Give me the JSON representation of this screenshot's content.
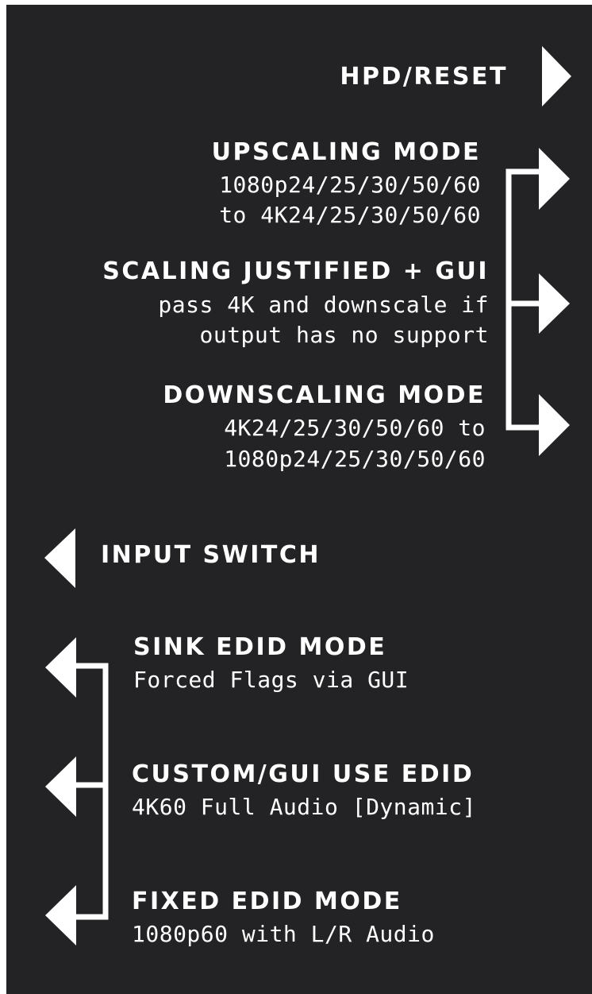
{
  "colors": {
    "background": "#232224",
    "foreground": "#ffffff",
    "page": "#ffffff"
  },
  "right_group": {
    "hpd_reset": {
      "title": "HPD/RESET",
      "icon": "arrow-right-icon"
    },
    "upscaling": {
      "title": "UPSCALING MODE",
      "line1": "1080p24/25/30/50/60",
      "line2": "to 4K24/25/30/50/60",
      "icon": "arrow-right-icon"
    },
    "scaling_justified": {
      "title": "SCALING JUSTIFIED + GUI",
      "line1": "pass 4K and downscale if",
      "line2": "output has no support",
      "icon": "arrow-right-icon"
    },
    "downscaling": {
      "title": "DOWNSCALING MODE",
      "line1": "4K24/25/30/50/60 to",
      "line2": "1080p24/25/30/50/60",
      "icon": "arrow-right-icon"
    }
  },
  "left_group": {
    "input_switch": {
      "title": "INPUT SWITCH",
      "icon": "arrow-left-icon"
    },
    "sink_edid": {
      "title": "SINK EDID MODE",
      "line1": "Forced Flags via GUI",
      "icon": "arrow-left-icon"
    },
    "custom_edid": {
      "title": "CUSTOM/GUI USE EDID",
      "line1": "4K60 Full Audio [Dynamic]",
      "icon": "arrow-left-icon"
    },
    "fixed_edid": {
      "title": "FIXED EDID MODE",
      "line1": "1080p60 with L/R Audio",
      "icon": "arrow-left-icon"
    }
  }
}
